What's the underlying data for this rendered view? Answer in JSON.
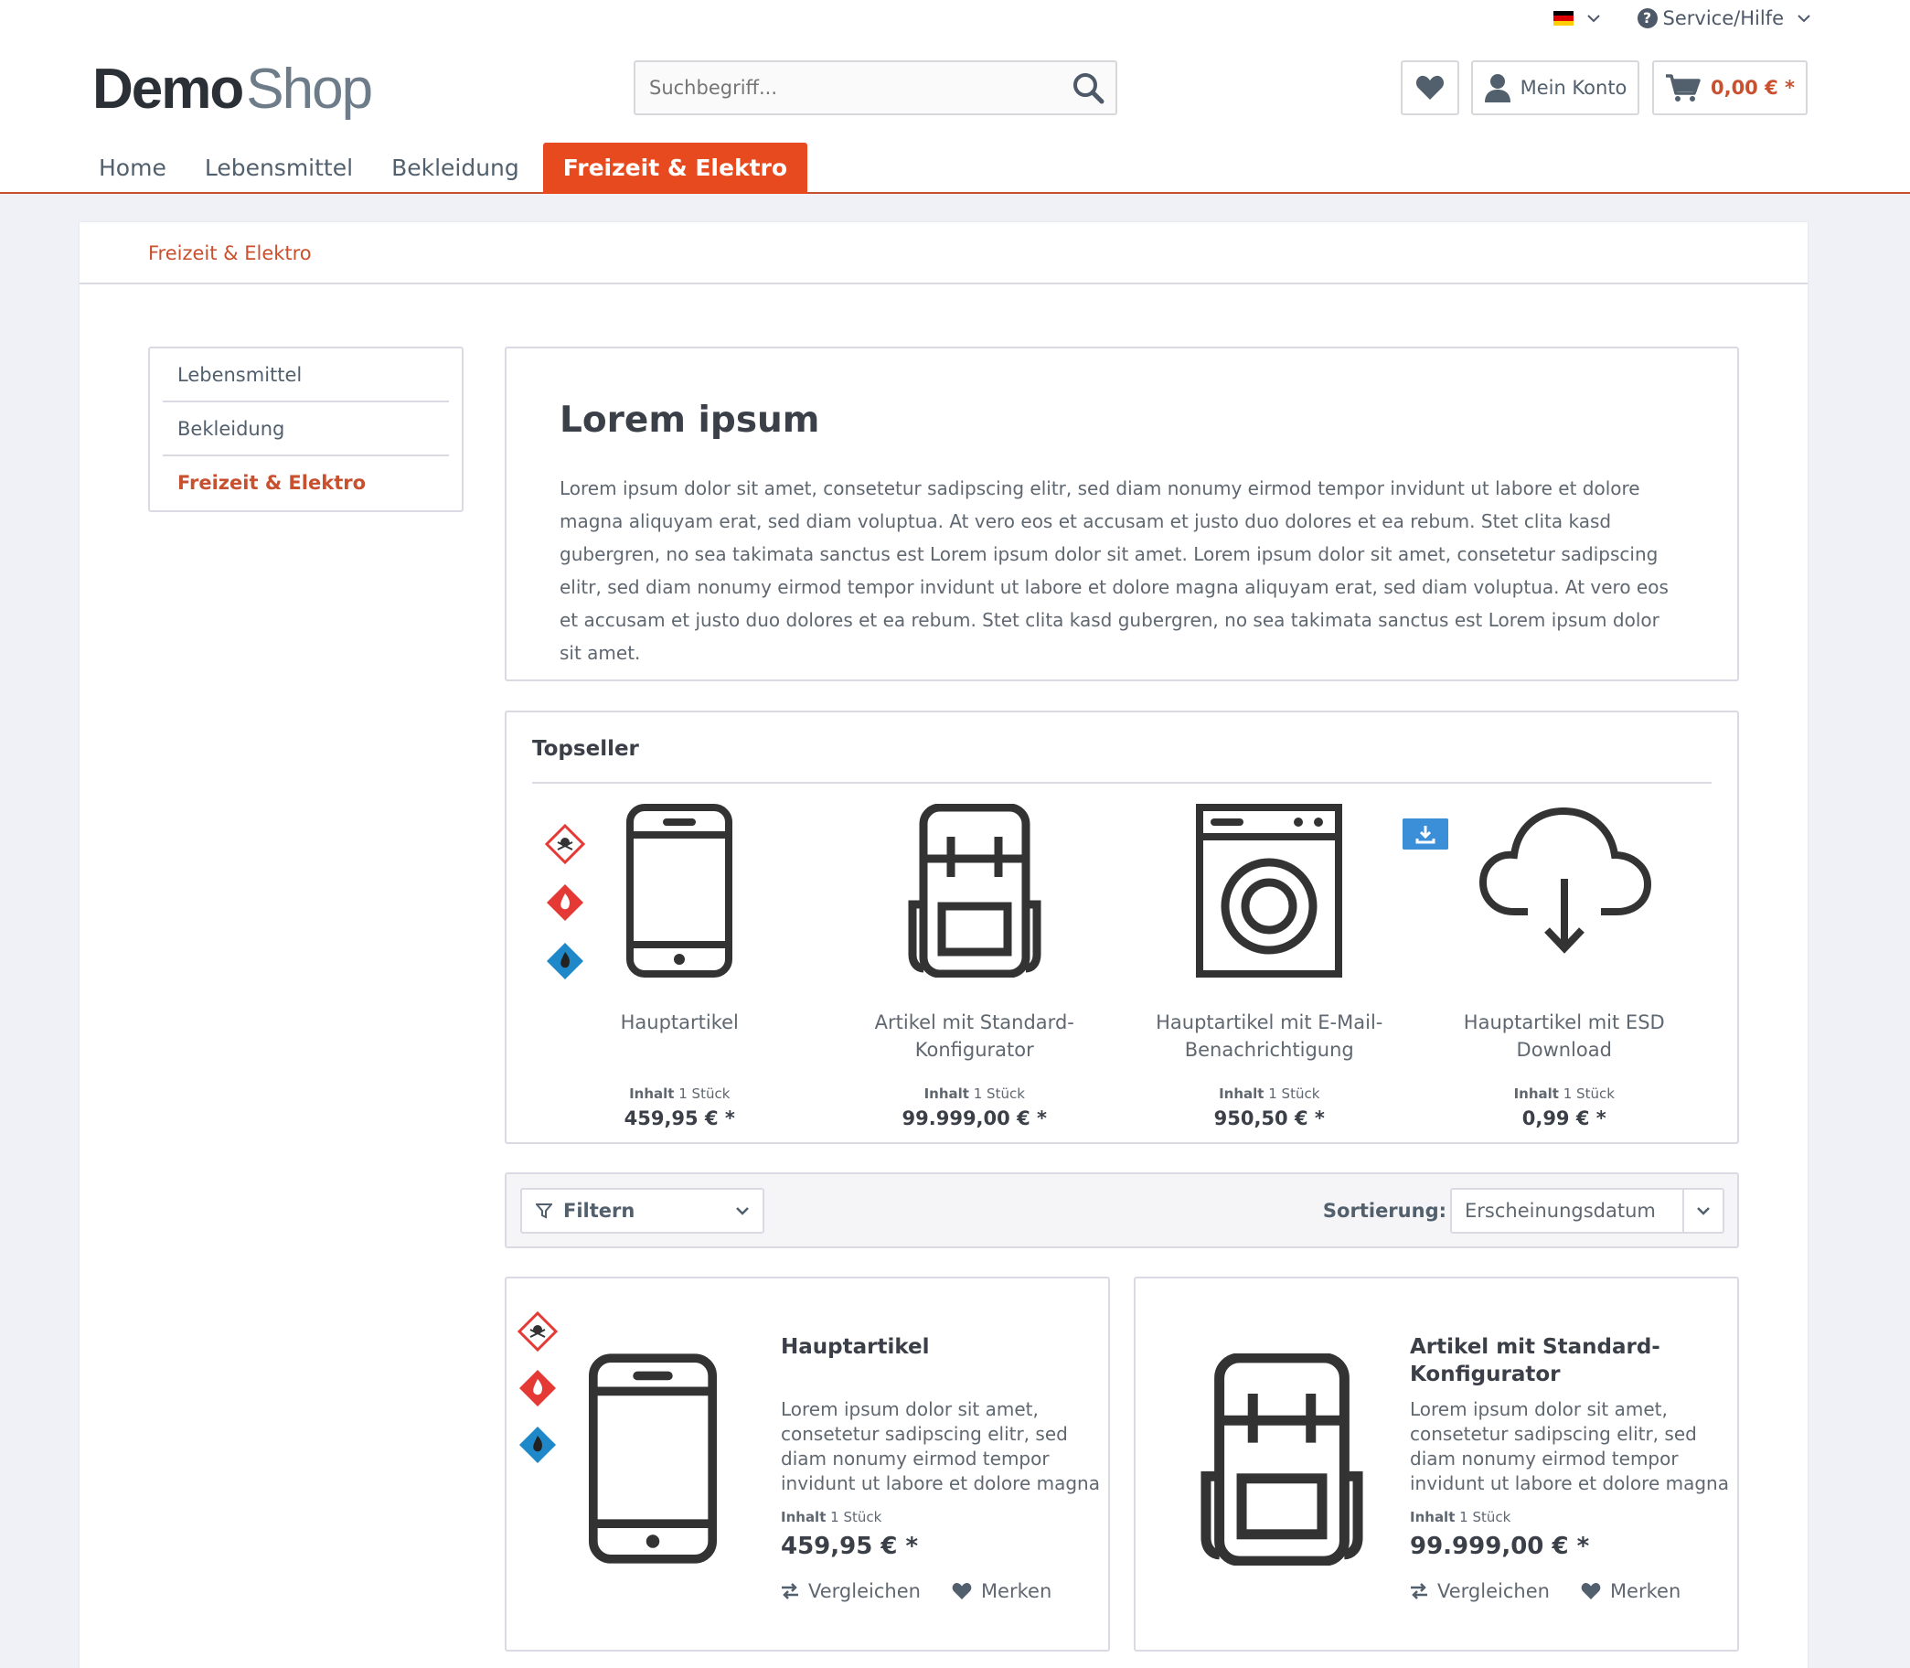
{
  "topbar": {
    "service_label": "Service/Hilfe",
    "flag_colors": [
      "#000000",
      "#dd0000",
      "#ffce00"
    ]
  },
  "logo": {
    "part1": "Demo",
    "part2": "Shop"
  },
  "search": {
    "placeholder": "Suchbegriff..."
  },
  "header_buttons": {
    "account_label": "Mein Konto",
    "cart_total": "0,00 € *"
  },
  "nav": {
    "items": [
      "Home",
      "Lebensmittel",
      "Bekleidung",
      "Freizeit & Elektro"
    ]
  },
  "breadcrumb": {
    "current": "Freizeit & Elektro"
  },
  "sidebar": {
    "items": [
      "Lebensmittel",
      "Bekleidung",
      "Freizeit & Elektro"
    ]
  },
  "intro": {
    "title": "Lorem ipsum",
    "text": "Lorem ipsum dolor sit amet, consetetur sadipscing elitr, sed diam nonumy eirmod tempor invidunt ut labore et dolore magna aliquyam erat, sed diam voluptua. At vero eos et accusam et justo duo dolores et ea rebum. Stet clita kasd gubergren, no sea takimata sanctus est Lorem ipsum dolor sit amet. Lorem ipsum dolor sit amet, consetetur sadipscing elitr, sed diam nonumy eirmod tempor invidunt ut labore et dolore magna aliquyam erat, sed diam voluptua. At vero eos et accusam et justo duo dolores et ea rebum. Stet clita kasd gubergren, no sea takimata sanctus est Lorem ipsum dolor sit amet."
  },
  "topseller": {
    "heading": "Topseller",
    "inhalt_label": "Inhalt",
    "items": [
      {
        "title": "Hauptartikel",
        "inhalt": "1 Stück",
        "price": "459,95 € *",
        "icon": "smartphone-icon"
      },
      {
        "title": "Artikel mit Standard-Konfigurator",
        "inhalt": "1 Stück",
        "price": "99.999,00 € *",
        "icon": "backpack-icon"
      },
      {
        "title": "Hauptartikel mit E-Mail-Benachrichtigung",
        "inhalt": "1 Stück",
        "price": "950,50 € *",
        "icon": "washing-machine-icon"
      },
      {
        "title": "Hauptartikel mit ESD Download",
        "inhalt": "1 Stück",
        "price": "0,99 € *",
        "icon": "cloud-download-icon"
      }
    ]
  },
  "listing": {
    "filter_label": "Filtern",
    "sort_label": "Sortierung:",
    "sort_value": "Erscheinungsdatum",
    "compare_label": "Vergleichen",
    "remember_label": "Merken",
    "inhalt_label": "Inhalt",
    "products": [
      {
        "title": "Hauptartikel",
        "desc": "Lorem ipsum dolor sit amet, consetetur sadipscing elitr, sed diam nonumy eirmod tempor invidunt ut labore et dolore magna",
        "inhalt": "1 Stück",
        "price": "459,95 € *"
      },
      {
        "title": "Artikel mit Standard-Konfigurator",
        "desc": "Lorem ipsum dolor sit amet, consetetur sadipscing elitr, sed diam nonumy eirmod tempor invidunt ut labore et dolore magna",
        "inhalt": "1 Stück",
        "price": "99.999,00 € *"
      }
    ]
  },
  "colors": {
    "accent": "#e84a1f",
    "accent_text": "#c9502f",
    "text_dark": "#3a3f48",
    "border": "#dadae5"
  }
}
